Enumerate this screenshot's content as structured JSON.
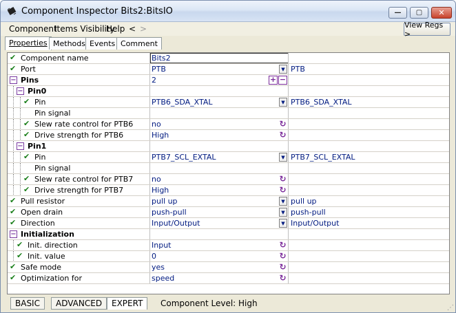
{
  "window": {
    "title": "Component Inspector Bits2:BitsIO",
    "minimize_glyph": "—",
    "maximize_glyph": "▢",
    "close_glyph": "✕"
  },
  "menu": {
    "items": [
      "Component",
      "Items Visibility",
      "Help",
      "<",
      ">"
    ],
    "view_regs": "View Regs >"
  },
  "tabs": [
    "Properties",
    "Methods",
    "Events",
    "Comment"
  ],
  "rows": [
    {
      "check": "✔",
      "name": "Component name",
      "value": "Bits2",
      "extra": "",
      "ctrl": "edit"
    },
    {
      "check": "✔",
      "name": "Port",
      "value": "PTB",
      "extra": "PTB",
      "ctrl": "dropdown"
    },
    {
      "expander": "−",
      "name": "Pins",
      "value": "2",
      "extra": "",
      "ctrl": "plusminus",
      "bold": true
    },
    {
      "expander": "−",
      "name": "Pin0",
      "value": "",
      "extra": "",
      "ctrl": "",
      "bold": true
    },
    {
      "check": "✔",
      "name": "Pin",
      "value": "PTB6_SDA_XTAL",
      "extra": "PTB6_SDA_XTAL",
      "ctrl": "dropdown"
    },
    {
      "check": "",
      "name": "Pin signal",
      "value": "",
      "extra": "",
      "ctrl": ""
    },
    {
      "check": "✔",
      "name": "Slew rate control for PTB6",
      "value": "no",
      "extra": "",
      "ctrl": "reset"
    },
    {
      "check": "✔",
      "name": "Drive strength for PTB6",
      "value": "High",
      "extra": "",
      "ctrl": "reset"
    },
    {
      "expander": "−",
      "name": "Pin1",
      "value": "",
      "extra": "",
      "ctrl": "",
      "bold": true
    },
    {
      "check": "✔",
      "name": "Pin",
      "value": "PTB7_SCL_EXTAL",
      "extra": "PTB7_SCL_EXTAL",
      "ctrl": "dropdown"
    },
    {
      "check": "",
      "name": "Pin signal",
      "value": "",
      "extra": "",
      "ctrl": ""
    },
    {
      "check": "✔",
      "name": "Slew rate control for PTB7",
      "value": "no",
      "extra": "",
      "ctrl": "reset"
    },
    {
      "check": "✔",
      "name": "Drive strength for PTB7",
      "value": "High",
      "extra": "",
      "ctrl": "reset"
    },
    {
      "check": "✔",
      "name": "Pull resistor",
      "value": "pull up",
      "extra": "pull up",
      "ctrl": "dropdown"
    },
    {
      "check": "✔",
      "name": "Open drain",
      "value": "push-pull",
      "extra": "push-pull",
      "ctrl": "dropdown"
    },
    {
      "check": "✔",
      "name": "Direction",
      "value": "Input/Output",
      "extra": "Input/Output",
      "ctrl": "dropdown"
    },
    {
      "expander": "−",
      "name": "Initialization",
      "value": "",
      "extra": "",
      "ctrl": "",
      "bold": true
    },
    {
      "check": "✔",
      "name": "Init. direction",
      "value": "Input",
      "extra": "",
      "ctrl": "reset"
    },
    {
      "check": "✔",
      "name": "Init. value",
      "value": "0",
      "extra": "",
      "ctrl": "reset"
    },
    {
      "check": "✔",
      "name": "Safe mode",
      "value": "yes",
      "extra": "",
      "ctrl": "reset"
    },
    {
      "check": "✔",
      "name": "Optimization for",
      "value": "speed",
      "extra": "",
      "ctrl": "reset"
    }
  ],
  "levels": [
    "BASIC",
    "ADVANCED",
    "EXPERT"
  ],
  "component_level": "Component Level: High",
  "icons": {
    "reset": "↻",
    "dropdown": "▼",
    "plus": "+",
    "minus": "−",
    "grip": "⋰"
  },
  "colors": {
    "check": "#1a7f1a",
    "value_text": "#001a80",
    "accent": "#7a2a9a"
  }
}
